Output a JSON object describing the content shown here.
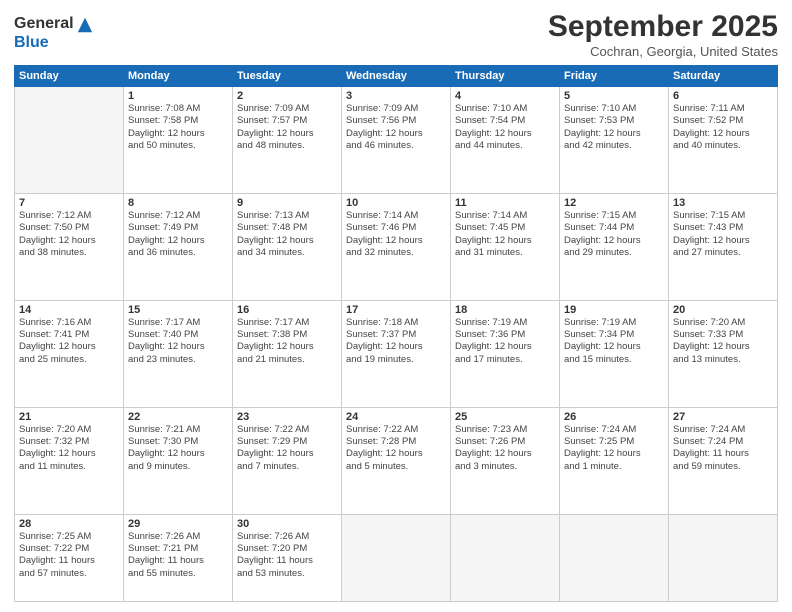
{
  "logo": {
    "general": "General",
    "blue": "Blue"
  },
  "header": {
    "month": "September 2025",
    "location": "Cochran, Georgia, United States"
  },
  "weekdays": [
    "Sunday",
    "Monday",
    "Tuesday",
    "Wednesday",
    "Thursday",
    "Friday",
    "Saturday"
  ],
  "weeks": [
    [
      {
        "day": "",
        "info": ""
      },
      {
        "day": "1",
        "info": "Sunrise: 7:08 AM\nSunset: 7:58 PM\nDaylight: 12 hours\nand 50 minutes."
      },
      {
        "day": "2",
        "info": "Sunrise: 7:09 AM\nSunset: 7:57 PM\nDaylight: 12 hours\nand 48 minutes."
      },
      {
        "day": "3",
        "info": "Sunrise: 7:09 AM\nSunset: 7:56 PM\nDaylight: 12 hours\nand 46 minutes."
      },
      {
        "day": "4",
        "info": "Sunrise: 7:10 AM\nSunset: 7:54 PM\nDaylight: 12 hours\nand 44 minutes."
      },
      {
        "day": "5",
        "info": "Sunrise: 7:10 AM\nSunset: 7:53 PM\nDaylight: 12 hours\nand 42 minutes."
      },
      {
        "day": "6",
        "info": "Sunrise: 7:11 AM\nSunset: 7:52 PM\nDaylight: 12 hours\nand 40 minutes."
      }
    ],
    [
      {
        "day": "7",
        "info": "Sunrise: 7:12 AM\nSunset: 7:50 PM\nDaylight: 12 hours\nand 38 minutes."
      },
      {
        "day": "8",
        "info": "Sunrise: 7:12 AM\nSunset: 7:49 PM\nDaylight: 12 hours\nand 36 minutes."
      },
      {
        "day": "9",
        "info": "Sunrise: 7:13 AM\nSunset: 7:48 PM\nDaylight: 12 hours\nand 34 minutes."
      },
      {
        "day": "10",
        "info": "Sunrise: 7:14 AM\nSunset: 7:46 PM\nDaylight: 12 hours\nand 32 minutes."
      },
      {
        "day": "11",
        "info": "Sunrise: 7:14 AM\nSunset: 7:45 PM\nDaylight: 12 hours\nand 31 minutes."
      },
      {
        "day": "12",
        "info": "Sunrise: 7:15 AM\nSunset: 7:44 PM\nDaylight: 12 hours\nand 29 minutes."
      },
      {
        "day": "13",
        "info": "Sunrise: 7:15 AM\nSunset: 7:43 PM\nDaylight: 12 hours\nand 27 minutes."
      }
    ],
    [
      {
        "day": "14",
        "info": "Sunrise: 7:16 AM\nSunset: 7:41 PM\nDaylight: 12 hours\nand 25 minutes."
      },
      {
        "day": "15",
        "info": "Sunrise: 7:17 AM\nSunset: 7:40 PM\nDaylight: 12 hours\nand 23 minutes."
      },
      {
        "day": "16",
        "info": "Sunrise: 7:17 AM\nSunset: 7:38 PM\nDaylight: 12 hours\nand 21 minutes."
      },
      {
        "day": "17",
        "info": "Sunrise: 7:18 AM\nSunset: 7:37 PM\nDaylight: 12 hours\nand 19 minutes."
      },
      {
        "day": "18",
        "info": "Sunrise: 7:19 AM\nSunset: 7:36 PM\nDaylight: 12 hours\nand 17 minutes."
      },
      {
        "day": "19",
        "info": "Sunrise: 7:19 AM\nSunset: 7:34 PM\nDaylight: 12 hours\nand 15 minutes."
      },
      {
        "day": "20",
        "info": "Sunrise: 7:20 AM\nSunset: 7:33 PM\nDaylight: 12 hours\nand 13 minutes."
      }
    ],
    [
      {
        "day": "21",
        "info": "Sunrise: 7:20 AM\nSunset: 7:32 PM\nDaylight: 12 hours\nand 11 minutes."
      },
      {
        "day": "22",
        "info": "Sunrise: 7:21 AM\nSunset: 7:30 PM\nDaylight: 12 hours\nand 9 minutes."
      },
      {
        "day": "23",
        "info": "Sunrise: 7:22 AM\nSunset: 7:29 PM\nDaylight: 12 hours\nand 7 minutes."
      },
      {
        "day": "24",
        "info": "Sunrise: 7:22 AM\nSunset: 7:28 PM\nDaylight: 12 hours\nand 5 minutes."
      },
      {
        "day": "25",
        "info": "Sunrise: 7:23 AM\nSunset: 7:26 PM\nDaylight: 12 hours\nand 3 minutes."
      },
      {
        "day": "26",
        "info": "Sunrise: 7:24 AM\nSunset: 7:25 PM\nDaylight: 12 hours\nand 1 minute."
      },
      {
        "day": "27",
        "info": "Sunrise: 7:24 AM\nSunset: 7:24 PM\nDaylight: 11 hours\nand 59 minutes."
      }
    ],
    [
      {
        "day": "28",
        "info": "Sunrise: 7:25 AM\nSunset: 7:22 PM\nDaylight: 11 hours\nand 57 minutes."
      },
      {
        "day": "29",
        "info": "Sunrise: 7:26 AM\nSunset: 7:21 PM\nDaylight: 11 hours\nand 55 minutes."
      },
      {
        "day": "30",
        "info": "Sunrise: 7:26 AM\nSunset: 7:20 PM\nDaylight: 11 hours\nand 53 minutes."
      },
      {
        "day": "",
        "info": ""
      },
      {
        "day": "",
        "info": ""
      },
      {
        "day": "",
        "info": ""
      },
      {
        "day": "",
        "info": ""
      }
    ]
  ]
}
